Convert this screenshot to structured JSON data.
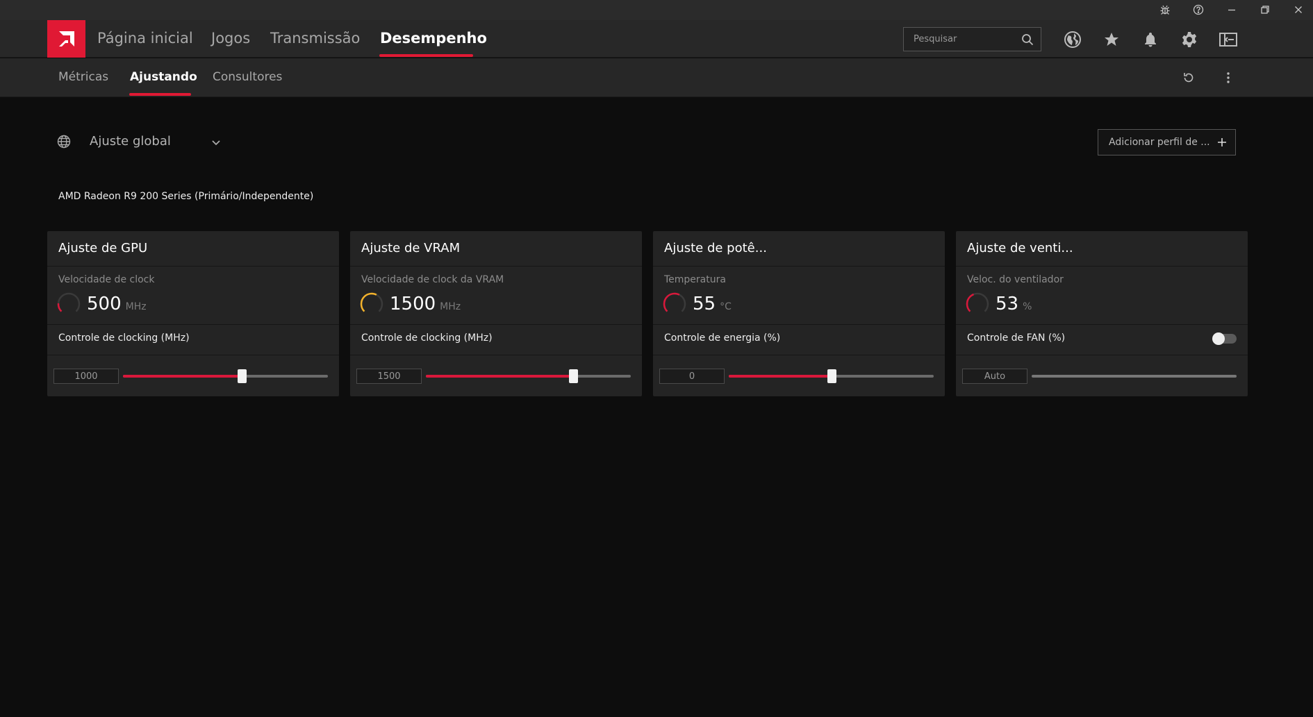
{
  "window": {
    "buttons": [
      {
        "name": "bug-report",
        "icon": "bug-icon"
      },
      {
        "name": "help",
        "icon": "help-icon"
      },
      {
        "name": "minimize",
        "icon": "minimize-icon"
      },
      {
        "name": "restore",
        "icon": "restore-icon"
      },
      {
        "name": "close",
        "icon": "close-icon"
      }
    ]
  },
  "nav": {
    "tabs": [
      {
        "label": "Página inicial"
      },
      {
        "label": "Jogos"
      },
      {
        "label": "Transmissão"
      },
      {
        "label": "Desempenho",
        "active": true
      }
    ],
    "search_placeholder": "Pesquisar",
    "icons": [
      "globe-icon",
      "star-icon",
      "bell-icon",
      "gear-icon",
      "sidebar-layout-icon"
    ]
  },
  "subnav": {
    "tabs": [
      {
        "label": "Métricas"
      },
      {
        "label": "Ajustando",
        "active": true
      },
      {
        "label": "Consultores"
      }
    ],
    "icons": [
      "reset-icon",
      "more-vertical-icon"
    ]
  },
  "profile": {
    "selected": "Ajuste global",
    "add_label": "Adicionar perfil de ..."
  },
  "gpu_name": "AMD Radeon R9 200 Series (Primário/Independente)",
  "colors": {
    "accent": "#e01934",
    "slider_fill": "#d9183b",
    "gauge_yellow": "#f3b22b"
  },
  "cards": [
    {
      "title": "Ajuste de GPU",
      "metric_label": "Velocidade de clock",
      "metric_value": "500",
      "metric_unit": "MHz",
      "gauge_fraction": 0.18,
      "gauge_color": "#d9183b",
      "control_label": "Controle de clocking (MHz)",
      "input_value": "1000",
      "slider_fraction": 0.58
    },
    {
      "title": "Ajuste de VRAM",
      "metric_label": "Velocidade de clock da VRAM",
      "metric_value": "1500",
      "metric_unit": "MHz",
      "gauge_fraction": 0.6,
      "gauge_color": "#f3b22b",
      "control_label": "Controle de clocking (MHz)",
      "input_value": "1500",
      "slider_fraction": 0.72
    },
    {
      "title": "Ajuste de potê...",
      "metric_label": "Temperatura",
      "metric_value": "55",
      "metric_unit": "°C",
      "gauge_fraction": 0.6,
      "gauge_color": "#d9183b",
      "control_label": "Controle de energia (%)",
      "input_value": "0",
      "slider_fraction": 0.5
    },
    {
      "title": "Ajuste de venti...",
      "metric_label": "Veloc. do ventilador",
      "metric_value": "53",
      "metric_unit": "%",
      "gauge_fraction": 0.42,
      "gauge_color": "#d9183b",
      "control_label": "Controle de FAN (%)",
      "has_toggle": true,
      "toggle_on": false,
      "input_value": "Auto",
      "slider_fraction": null
    }
  ]
}
